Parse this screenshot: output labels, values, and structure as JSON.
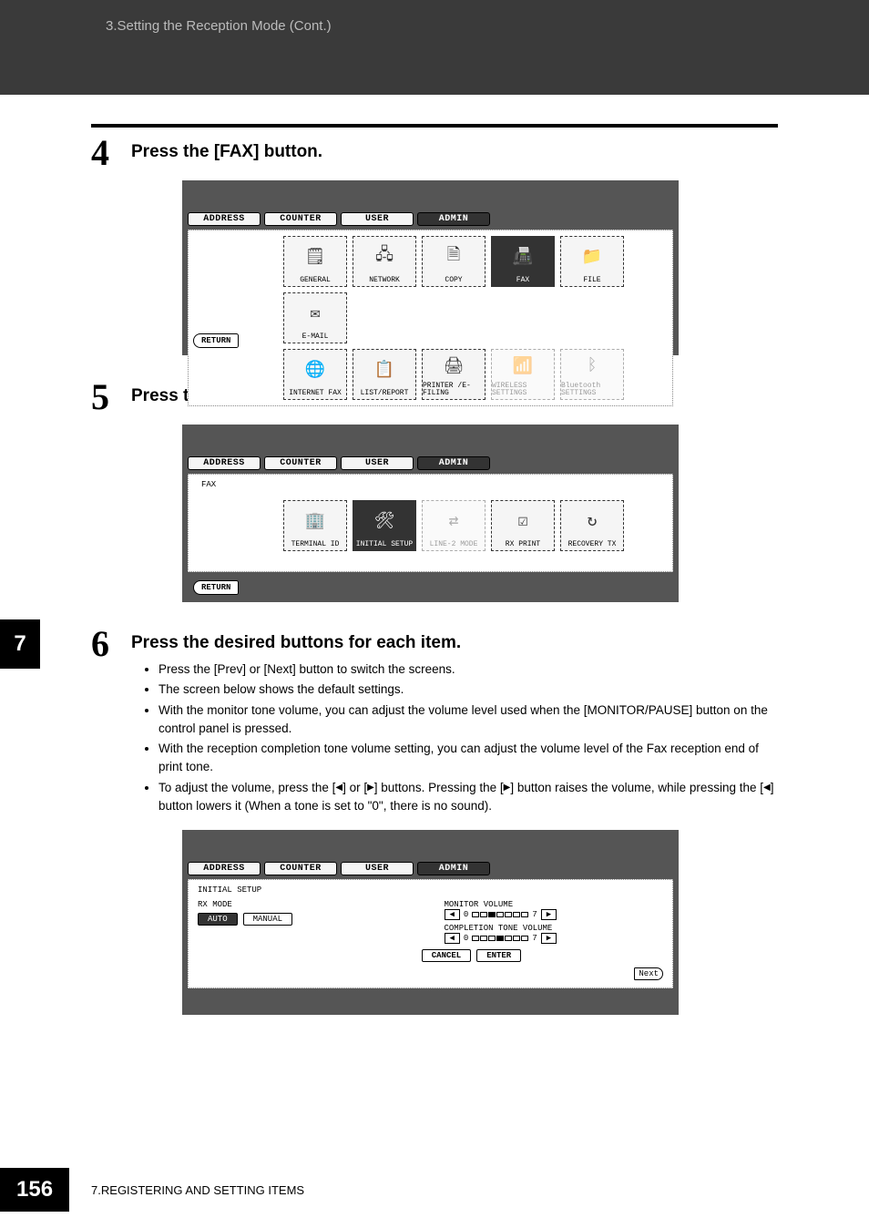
{
  "header": {
    "breadcrumb": "3.Setting the Reception Mode (Cont.)"
  },
  "chapter_tab": "7",
  "steps": {
    "s4": {
      "num": "4",
      "title": "Press the [FAX] button."
    },
    "s5": {
      "num": "5",
      "title": "Press the [INITIAL SETUP] button."
    },
    "s6": {
      "num": "6",
      "title": "Press the desired buttons for each item."
    }
  },
  "tabs": {
    "address": "ADDRESS",
    "counter": "COUNTER",
    "user": "USER",
    "admin": "ADMIN"
  },
  "screen1": {
    "buttons": {
      "general": "GENERAL",
      "network": "NETWORK",
      "copy": "COPY",
      "fax": "FAX",
      "file": "FILE",
      "email": "E-MAIL",
      "internet_fax": "INTERNET FAX",
      "list_report": "LIST/REPORT",
      "printer_efiling": "PRINTER\n/E-FILING",
      "wireless": "WIRELESS\nSETTINGS",
      "bluetooth": "Bluetooth\nSETTINGS"
    },
    "return": "RETURN"
  },
  "screen2": {
    "context": "FAX",
    "buttons": {
      "terminal_id": "TERMINAL ID",
      "initial_setup": "INITIAL SETUP",
      "line2_mode": "LINE-2 MODE",
      "rx_print": "RX PRINT",
      "recovery_tx": "RECOVERY TX"
    },
    "return": "RETURN"
  },
  "bullets": {
    "b1": "Press the [Prev] or [Next] button to switch the screens.",
    "b2": "The screen below shows the default settings.",
    "b3": "With the monitor tone volume, you can adjust the volume level used when the [MONITOR/PAUSE] button on the control panel is pressed.",
    "b4": "With the reception completion tone volume setting, you can adjust the volume level of the Fax reception end of print tone.",
    "b5_pre": "To adjust the volume, press the [",
    "b5_mid1": "] or [",
    "b5_mid2": "] buttons. Pressing the [",
    "b5_mid3": "] button raises the volume, while pressing the [",
    "b5_post": "] button lowers it (When a tone is set to \"0\", there is no sound)."
  },
  "screen3": {
    "context": "INITIAL SETUP",
    "rx_mode_label": "RX MODE",
    "rx_auto": "AUTO",
    "rx_manual": "MANUAL",
    "monitor_label": "MONITOR VOLUME",
    "completion_label": "COMPLETION TONE VOLUME",
    "scale_low": "0",
    "scale_high": "7",
    "cancel": "CANCEL",
    "enter": "ENTER",
    "next": "Next"
  },
  "footer": {
    "page": "156",
    "text": "7.REGISTERING AND SETTING ITEMS"
  }
}
